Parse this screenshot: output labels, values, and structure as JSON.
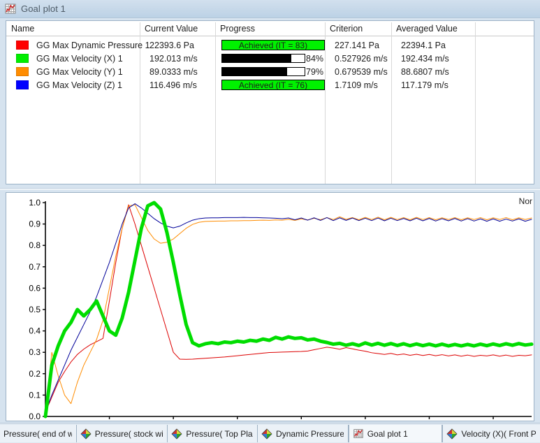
{
  "window": {
    "title": "Goal plot 1",
    "icon": "goal-plot-icon"
  },
  "table": {
    "columns": [
      "Name",
      "Current Value",
      "Progress",
      "Criterion",
      "Averaged Value"
    ],
    "rows": [
      {
        "color": "#ff0000",
        "name": "GG Max Dynamic Pressure 1",
        "current_value": "22393.6 Pa",
        "progress_kind": "achieved",
        "progress_label": "Achieved (IT = 83)",
        "progress_percent": 100,
        "criterion": "227.141 Pa",
        "averaged_value": "22394.1 Pa"
      },
      {
        "color": "#00ee00",
        "name": "GG Max Velocity (X) 1",
        "current_value": "192.013 m/s",
        "progress_kind": "bar",
        "progress_label": "84%",
        "progress_percent": 84,
        "criterion": "0.527926 m/s",
        "averaged_value": "192.434 m/s"
      },
      {
        "color": "#ff8c00",
        "name": "GG Max Velocity (Y) 1",
        "current_value": "89.0333 m/s",
        "progress_kind": "bar",
        "progress_label": "79%",
        "progress_percent": 79,
        "criterion": "0.679539 m/s",
        "averaged_value": "88.6807 m/s"
      },
      {
        "color": "#0000ff",
        "name": "GG Max Velocity (Z) 1",
        "current_value": "116.496 m/s",
        "progress_kind": "achieved",
        "progress_label": "Achieved (IT = 76)",
        "progress_percent": 100,
        "criterion": "1.7109 m/s",
        "averaged_value": "117.179 m/s"
      }
    ]
  },
  "chart_data": {
    "type": "line",
    "title": "",
    "corner_label": "Nor",
    "xlabel": "",
    "ylabel": "",
    "xlim": [
      0,
      76
    ],
    "ylim": [
      0,
      1.0
    ],
    "xticks": [
      10,
      20,
      30,
      40,
      50,
      60,
      70
    ],
    "yticks": [
      "0.0",
      "0.1",
      "0.2",
      "0.3",
      "0.4",
      "0.5",
      "0.6",
      "0.7",
      "0.8",
      "0.9",
      "1.0"
    ],
    "grid": false,
    "legend_position": "none",
    "series": [
      {
        "name": "GG Max Dynamic Pressure 1",
        "color": "#dd0000",
        "width": 1,
        "x": [
          0,
          1,
          2,
          3,
          4,
          5,
          6,
          7,
          8,
          9,
          10,
          11,
          12,
          13,
          14,
          15,
          16,
          17,
          18,
          19,
          20,
          21,
          22,
          23,
          24,
          25,
          26,
          27,
          28,
          29,
          30,
          31,
          32,
          33,
          34,
          35,
          36,
          37,
          38,
          39,
          40,
          41,
          42,
          43,
          44,
          45,
          46,
          47,
          48,
          49,
          50,
          51,
          52,
          53,
          54,
          55,
          56,
          57,
          58,
          59,
          60,
          61,
          62,
          63,
          64,
          65,
          66,
          67,
          68,
          69,
          70,
          71,
          72,
          73,
          74,
          75,
          76
        ],
        "values": [
          0.02,
          0.09,
          0.16,
          0.21,
          0.255,
          0.29,
          0.315,
          0.335,
          0.35,
          0.365,
          0.54,
          0.72,
          0.88,
          0.99,
          0.9,
          0.8,
          0.7,
          0.6,
          0.5,
          0.4,
          0.3,
          0.268,
          0.267,
          0.268,
          0.27,
          0.272,
          0.274,
          0.276,
          0.278,
          0.281,
          0.284,
          0.287,
          0.29,
          0.293,
          0.296,
          0.299,
          0.3,
          0.301,
          0.302,
          0.303,
          0.304,
          0.306,
          0.312,
          0.318,
          0.324,
          0.32,
          0.314,
          0.322,
          0.316,
          0.31,
          0.305,
          0.298,
          0.294,
          0.29,
          0.295,
          0.288,
          0.292,
          0.286,
          0.291,
          0.285,
          0.29,
          0.284,
          0.289,
          0.283,
          0.288,
          0.282,
          0.287,
          0.281,
          0.286,
          0.283,
          0.288,
          0.282,
          0.287,
          0.281,
          0.286,
          0.284,
          0.288
        ]
      },
      {
        "name": "GG Max Velocity (Y) 1",
        "color": "#ff8c00",
        "width": 1,
        "x": [
          0,
          1,
          2,
          3,
          4,
          5,
          6,
          7,
          8,
          9,
          10,
          11,
          12,
          13,
          14,
          15,
          16,
          17,
          18,
          19,
          20,
          21,
          22,
          23,
          24,
          25,
          26,
          27,
          28,
          29,
          30,
          31,
          32,
          33,
          34,
          35,
          36,
          37,
          38,
          39,
          40,
          41,
          42,
          43,
          44,
          45,
          46,
          47,
          48,
          49,
          50,
          51,
          52,
          53,
          54,
          55,
          56,
          57,
          58,
          59,
          60,
          61,
          62,
          63,
          64,
          65,
          66,
          67,
          68,
          69,
          70,
          71,
          72,
          73,
          74,
          75,
          76
        ],
        "values": [
          0.0,
          0.3,
          0.19,
          0.1,
          0.06,
          0.16,
          0.24,
          0.3,
          0.36,
          0.45,
          0.6,
          0.75,
          0.88,
          0.985,
          0.99,
          0.93,
          0.87,
          0.83,
          0.81,
          0.815,
          0.83,
          0.855,
          0.88,
          0.898,
          0.908,
          0.912,
          0.913,
          0.914,
          0.914,
          0.915,
          0.915,
          0.916,
          0.916,
          0.917,
          0.918,
          0.917,
          0.919,
          0.918,
          0.922,
          0.917,
          0.924,
          0.919,
          0.927,
          0.92,
          0.93,
          0.921,
          0.934,
          0.922,
          0.93,
          0.92,
          0.931,
          0.921,
          0.932,
          0.92,
          0.931,
          0.921,
          0.93,
          0.92,
          0.931,
          0.921,
          0.93,
          0.92,
          0.929,
          0.921,
          0.93,
          0.92,
          0.929,
          0.921,
          0.93,
          0.92,
          0.929,
          0.921,
          0.93,
          0.92,
          0.929,
          0.921,
          0.928
        ]
      },
      {
        "name": "GG Max Velocity (Z) 1",
        "color": "#000099",
        "width": 1,
        "x": [
          0,
          1,
          2,
          3,
          4,
          5,
          6,
          7,
          8,
          9,
          10,
          11,
          12,
          13,
          14,
          15,
          16,
          17,
          18,
          19,
          20,
          21,
          22,
          23,
          24,
          25,
          26,
          27,
          28,
          29,
          30,
          31,
          32,
          33,
          34,
          35,
          36,
          37,
          38,
          39,
          40,
          41,
          42,
          43,
          44,
          45,
          46,
          47,
          48,
          49,
          50,
          51,
          52,
          53,
          54,
          55,
          56,
          57,
          58,
          59,
          60,
          61,
          62,
          63,
          64,
          65,
          66,
          67,
          68,
          69,
          70,
          71,
          72,
          73,
          74,
          75,
          76
        ],
        "values": [
          0.02,
          0.1,
          0.17,
          0.24,
          0.31,
          0.37,
          0.43,
          0.49,
          0.56,
          0.64,
          0.72,
          0.81,
          0.9,
          0.975,
          0.995,
          0.975,
          0.95,
          0.925,
          0.905,
          0.89,
          0.882,
          0.89,
          0.905,
          0.918,
          0.925,
          0.928,
          0.929,
          0.929,
          0.93,
          0.93,
          0.93,
          0.931,
          0.93,
          0.93,
          0.929,
          0.928,
          0.927,
          0.925,
          0.928,
          0.92,
          0.928,
          0.918,
          0.929,
          0.917,
          0.93,
          0.916,
          0.929,
          0.917,
          0.928,
          0.916,
          0.927,
          0.916,
          0.928,
          0.915,
          0.927,
          0.916,
          0.926,
          0.915,
          0.927,
          0.915,
          0.926,
          0.914,
          0.925,
          0.915,
          0.926,
          0.914,
          0.925,
          0.914,
          0.924,
          0.913,
          0.924,
          0.913,
          0.923,
          0.914,
          0.924,
          0.913,
          0.922
        ]
      },
      {
        "name": "GG Max Velocity (X) 1",
        "color": "#00dd00",
        "width": 5,
        "x": [
          0,
          1,
          2,
          3,
          4,
          5,
          6,
          7,
          8,
          9,
          10,
          11,
          12,
          13,
          14,
          15,
          16,
          17,
          18,
          19,
          20,
          21,
          22,
          23,
          24,
          25,
          26,
          27,
          28,
          29,
          30,
          31,
          32,
          33,
          34,
          35,
          36,
          37,
          38,
          39,
          40,
          41,
          42,
          43,
          44,
          45,
          46,
          47,
          48,
          49,
          50,
          51,
          52,
          53,
          54,
          55,
          56,
          57,
          58,
          59,
          60,
          61,
          62,
          63,
          64,
          65,
          66,
          67,
          68,
          69,
          70,
          71,
          72,
          73,
          74,
          75,
          76
        ],
        "values": [
          0.0,
          0.24,
          0.33,
          0.4,
          0.44,
          0.5,
          0.47,
          0.5,
          0.54,
          0.47,
          0.4,
          0.38,
          0.46,
          0.58,
          0.73,
          0.88,
          0.985,
          1.0,
          0.97,
          0.86,
          0.72,
          0.57,
          0.43,
          0.345,
          0.33,
          0.34,
          0.345,
          0.34,
          0.348,
          0.345,
          0.352,
          0.348,
          0.356,
          0.352,
          0.362,
          0.356,
          0.37,
          0.362,
          0.372,
          0.365,
          0.368,
          0.358,
          0.362,
          0.352,
          0.346,
          0.338,
          0.342,
          0.333,
          0.34,
          0.332,
          0.344,
          0.334,
          0.342,
          0.333,
          0.341,
          0.332,
          0.34,
          0.331,
          0.339,
          0.331,
          0.338,
          0.33,
          0.338,
          0.33,
          0.337,
          0.33,
          0.337,
          0.33,
          0.338,
          0.331,
          0.339,
          0.332,
          0.34,
          0.333,
          0.341,
          0.334,
          0.338
        ]
      }
    ]
  },
  "tabs": [
    {
      "label": "Pressure( end of win",
      "icon": "none",
      "active": false
    },
    {
      "label": "Pressure( stock wing",
      "icon": "surface-plot-icon",
      "active": false
    },
    {
      "label": "Pressure( Top Plane",
      "icon": "surface-plot-icon",
      "active": false
    },
    {
      "label": "Dynamic Pressure( P",
      "icon": "surface-plot-icon",
      "active": false
    },
    {
      "label": "Goal plot 1",
      "icon": "goal-plot-icon",
      "active": true
    },
    {
      "label": "Velocity (X)( Front Pl",
      "icon": "surface-plot-icon",
      "active": false
    }
  ],
  "colors": {
    "achieved_green": "#00f200",
    "panel_border": "#9cb2c6",
    "window_bg": "#d6e3ef"
  }
}
